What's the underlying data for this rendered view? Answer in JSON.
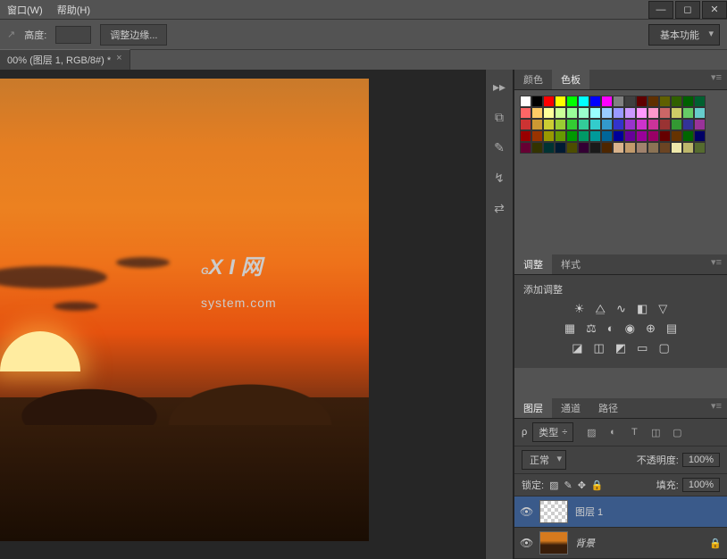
{
  "menu": {
    "window": "窗口(W)",
    "help": "帮助(H)"
  },
  "toolbar": {
    "height_label": "高度:",
    "refine": "调整边缘..."
  },
  "workspace": {
    "label": "基本功能"
  },
  "doc_tab": {
    "label": "00% (图层 1, RGB/8#) *",
    "close": "×"
  },
  "watermark": {
    "big": "G",
    "text1": "X I 网",
    "text2": "system.com"
  },
  "color_panel": {
    "tab1": "颜色",
    "tab2": "色板"
  },
  "adjust_panel": {
    "tab1": "调整",
    "tab2": "样式",
    "heading": "添加调整"
  },
  "layers_panel": {
    "tab1": "图层",
    "tab2": "通道",
    "tab3": "路径",
    "kind": "类型",
    "blend": "正常",
    "opacity_label": "不透明度:",
    "opacity_val": "100%",
    "lock_label": "锁定:",
    "fill_label": "填充:",
    "fill_val": "100%",
    "layer1": "图层 1",
    "background": "背景"
  },
  "swatch_colors": [
    "#ffffff",
    "#000000",
    "#ff0000",
    "#ffff00",
    "#00ff00",
    "#00ffff",
    "#0000ff",
    "#ff00ff",
    "#808080",
    "#404040",
    "#600000",
    "#603000",
    "#606000",
    "#306000",
    "#006000",
    "#006030",
    "#ff6666",
    "#ffcc66",
    "#ffff99",
    "#ccff99",
    "#99ff99",
    "#99ffcc",
    "#99ffff",
    "#99ccff",
    "#9999ff",
    "#cc99ff",
    "#ff99ff",
    "#ff99cc",
    "#cc6666",
    "#cccc66",
    "#66cc66",
    "#66cccc",
    "#cc3333",
    "#cc9933",
    "#cccc33",
    "#99cc33",
    "#33cc33",
    "#33cc99",
    "#33cccc",
    "#3399cc",
    "#3333cc",
    "#9933cc",
    "#cc33cc",
    "#cc3399",
    "#993333",
    "#339933",
    "#333399",
    "#993399",
    "#990000",
    "#993300",
    "#999900",
    "#669900",
    "#009900",
    "#009966",
    "#009999",
    "#006699",
    "#000099",
    "#660099",
    "#990099",
    "#990066",
    "#660000",
    "#663300",
    "#006600",
    "#000066",
    "#660033",
    "#333300",
    "#003333",
    "#001a33",
    "#4d4d00",
    "#330033",
    "#1a1a1a",
    "#4d2600",
    "#d9b38c",
    "#c19a6b",
    "#a0826d",
    "#8b7355",
    "#6b4423",
    "#eee8aa",
    "#bdb76b",
    "#556b2f"
  ]
}
